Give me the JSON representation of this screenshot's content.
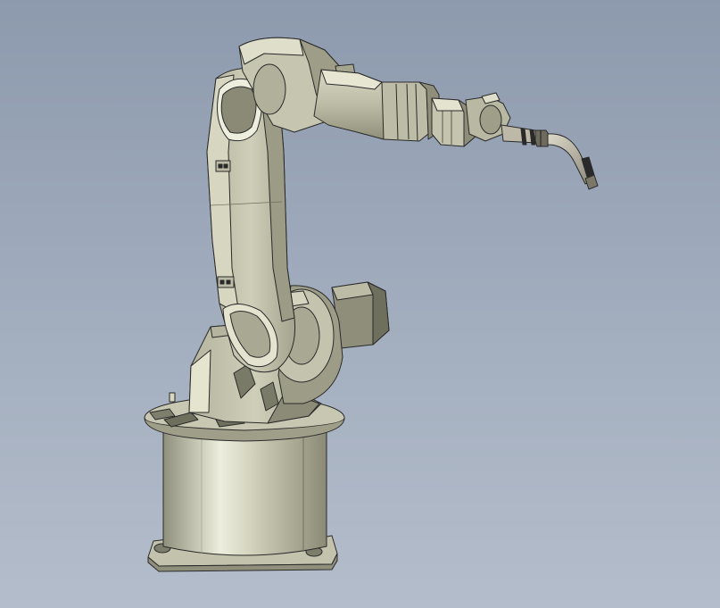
{
  "scene": {
    "background_top": "#8d9aad",
    "background_bottom": "#b4bdcb",
    "body_color": "#c9c9b3",
    "shadow_color": "#8f8f7c",
    "highlight_color": "#eeeede",
    "edge_color": "#2a2a2a",
    "torch_color": "#b9b4a4"
  },
  "icons": [
    "robot-arm-icon"
  ]
}
